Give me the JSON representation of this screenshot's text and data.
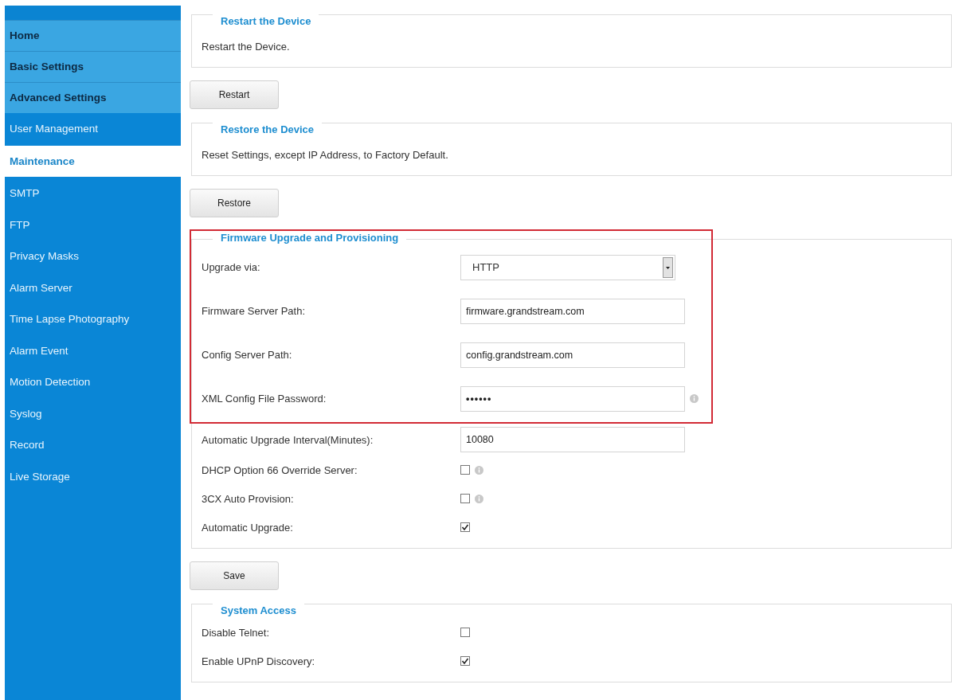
{
  "sidebar": {
    "items": [
      {
        "label": "Home",
        "kind": "category",
        "selected": false
      },
      {
        "label": "Basic Settings",
        "kind": "category",
        "selected": false
      },
      {
        "label": "Advanced Settings",
        "kind": "category",
        "selected": false
      },
      {
        "label": "User Management",
        "kind": "link",
        "selected": false
      },
      {
        "label": "Maintenance",
        "kind": "link",
        "selected": true
      },
      {
        "label": "SMTP",
        "kind": "link",
        "selected": false
      },
      {
        "label": "FTP",
        "kind": "link",
        "selected": false
      },
      {
        "label": "Privacy Masks",
        "kind": "link",
        "selected": false
      },
      {
        "label": "Alarm Server",
        "kind": "link",
        "selected": false
      },
      {
        "label": "Time Lapse Photography",
        "kind": "link",
        "selected": false
      },
      {
        "label": "Alarm Event",
        "kind": "link",
        "selected": false
      },
      {
        "label": "Motion Detection",
        "kind": "link",
        "selected": false
      },
      {
        "label": "Syslog",
        "kind": "link",
        "selected": false
      },
      {
        "label": "Record",
        "kind": "link",
        "selected": false
      },
      {
        "label": "Live Storage",
        "kind": "link",
        "selected": false
      }
    ]
  },
  "sections": [
    {
      "legend": "Restart the Device",
      "rows": [
        {
          "kind": "text",
          "label": "Restart the Device."
        }
      ],
      "button": "Restart"
    },
    {
      "legend": "Restore the Device",
      "rows": [
        {
          "kind": "text",
          "label": "Reset Settings, except IP Address, to Factory Default."
        }
      ],
      "button": "Restore"
    },
    {
      "legend": "Firmware Upgrade and Provisioning",
      "highlight": {
        "rows": [
          {
            "kind": "select",
            "label": "Upgrade via:",
            "value": "HTTP"
          },
          {
            "kind": "input",
            "label": "Firmware Server Path:",
            "value": "firmware.grandstream.com"
          },
          {
            "kind": "input",
            "label": "Config Server Path:",
            "value": "config.grandstream.com"
          },
          {
            "kind": "password",
            "label": "XML Config File Password:",
            "value": "••••••",
            "info": true
          }
        ]
      },
      "rows": [
        {
          "kind": "input",
          "label": "Automatic Upgrade Interval(Minutes):",
          "value": "10080"
        },
        {
          "kind": "checkbox",
          "label": "DHCP Option 66 Override Server:",
          "checked": false,
          "info": true
        },
        {
          "kind": "checkbox",
          "label": "3CX Auto Provision:",
          "checked": false,
          "info": true
        },
        {
          "kind": "checkbox",
          "label": "Automatic Upgrade:",
          "checked": true
        }
      ],
      "button": "Save"
    },
    {
      "legend": "System Access",
      "rows": [
        {
          "kind": "checkbox",
          "label": "Disable Telnet:",
          "checked": false
        },
        {
          "kind": "checkbox",
          "label": "Enable UPnP Discovery:",
          "checked": true
        }
      ]
    }
  ]
}
